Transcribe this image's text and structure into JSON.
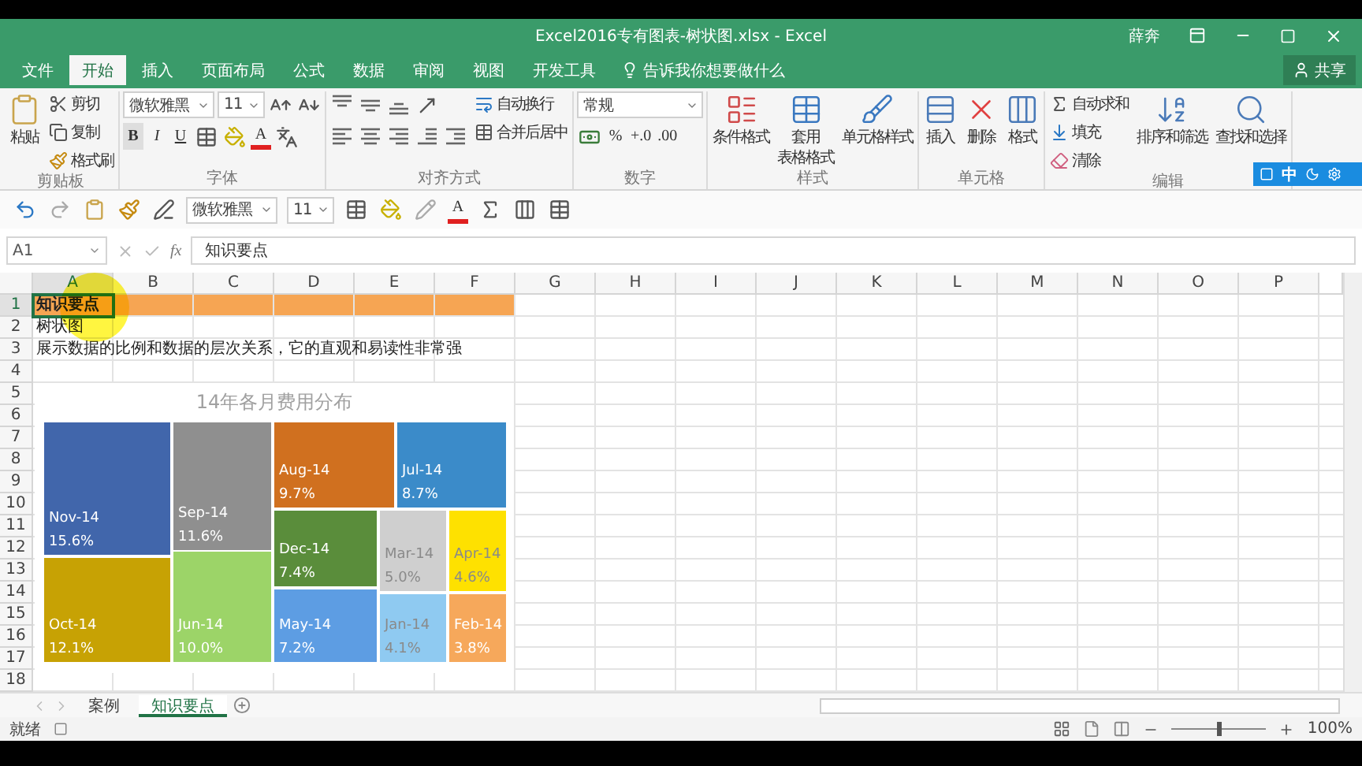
{
  "window": {
    "title": "Excel2016专有图表-树状图.xlsx - Excel",
    "user": "薛奔"
  },
  "menu_tabs": [
    {
      "label": "文件",
      "selected": false
    },
    {
      "label": "开始",
      "selected": true
    },
    {
      "label": "插入",
      "selected": false
    },
    {
      "label": "页面布局",
      "selected": false
    },
    {
      "label": "公式",
      "selected": false
    },
    {
      "label": "数据",
      "selected": false
    },
    {
      "label": "审阅",
      "selected": false
    },
    {
      "label": "视图",
      "selected": false
    },
    {
      "label": "开发工具",
      "selected": false
    }
  ],
  "tell_me": "告诉我你想要做什么",
  "share": "共享",
  "ribbon": {
    "groups": [
      {
        "label": "剪贴板",
        "columns": [
          [
            {
              "kind": "paste",
              "label": "粘贴"
            }
          ],
          [
            {
              "kind": "cut",
              "label": "剪切"
            },
            {
              "kind": "copy",
              "label": "复制"
            },
            {
              "kind": "brush",
              "label": "格式刷"
            }
          ]
        ]
      },
      {
        "label": "字体",
        "columns": [
          [
            {
              "kind": "row",
              "items": [
                {
                  "kind": "field",
                  "value": "微软雅黑"
                },
                {
                  "kind": "field",
                  "value": "11"
                },
                {
                  "kind": "grow"
                },
                {
                  "kind": "shrink"
                }
              ]
            },
            {
              "kind": "row",
              "items": [
                {
                  "kind": "bold",
                  "label": "B"
                },
                {
                  "kind": "italic",
                  "label": "I"
                },
                {
                  "kind": "underline",
                  "label": "U"
                },
                {
                  "kind": "border"
                },
                {
                  "kind": "fill"
                },
                {
                  "kind": "fontcolor",
                  "label": "A"
                },
                {
                  "kind": "phonetic"
                }
              ]
            }
          ]
        ]
      },
      {
        "label": "对齐方式",
        "columns": [
          [
            {
              "kind": "row",
              "items": [
                {
                  "kind": "vtop"
                },
                {
                  "kind": "vmid"
                },
                {
                  "kind": "vbottom"
                },
                {
                  "kind": "orient"
                }
              ]
            },
            {
              "kind": "row",
              "items": [
                {
                  "kind": "hleft"
                },
                {
                  "kind": "hcenter"
                },
                {
                  "kind": "hright"
                },
                {
                  "kind": "outdent"
                },
                {
                  "kind": "indent"
                }
              ]
            }
          ],
          [
            {
              "kind": "wrap",
              "label": "自动换行"
            },
            {
              "kind": "merge",
              "label": "合并后居中"
            }
          ]
        ]
      },
      {
        "label": "数字",
        "columns": [
          [
            {
              "kind": "field",
              "value": "常规"
            },
            {
              "kind": "row",
              "items": [
                {
                  "kind": "currency"
                },
                {
                  "kind": "percent",
                  "label": "%"
                },
                {
                  "kind": "decinc",
                  "label": "+.0"
                },
                {
                  "kind": "decdec",
                  "label": ".00"
                }
              ]
            }
          ]
        ]
      },
      {
        "label": "样式",
        "columns": [
          [
            {
              "kind": "condfmt",
              "label": "条件格式"
            }
          ],
          [
            {
              "kind": "tablefmt",
              "label_lines": [
                "套用",
                "表格格式"
              ]
            }
          ],
          [
            {
              "kind": "cellstyle",
              "label": "单元格样式"
            }
          ]
        ]
      },
      {
        "label": "单元格",
        "columns": [
          [
            {
              "kind": "insert",
              "label": "插入"
            }
          ],
          [
            {
              "kind": "delete",
              "label": "删除"
            }
          ],
          [
            {
              "kind": "format",
              "label": "格式"
            }
          ]
        ]
      },
      {
        "label": "编辑",
        "columns": [
          [
            {
              "kind": "sum",
              "label": "自动求和"
            },
            {
              "kind": "filldown",
              "label": "填充"
            },
            {
              "kind": "clear",
              "label": "清除"
            }
          ],
          [
            {
              "kind": "sort",
              "label": "排序和筛选"
            }
          ],
          [
            {
              "kind": "find",
              "label": "查找和选择"
            }
          ]
        ]
      }
    ]
  },
  "ime": {
    "label": "中"
  },
  "quick_toolbar": [
    {
      "kind": "undo"
    },
    {
      "kind": "redo"
    },
    {
      "kind": "paste"
    },
    {
      "kind": "brush"
    },
    {
      "kind": "quickedit"
    },
    {
      "kind": "field",
      "value": "微软雅黑"
    },
    {
      "kind": "field",
      "value": "11"
    },
    {
      "kind": "border"
    },
    {
      "kind": "fill"
    },
    {
      "kind": "pen"
    },
    {
      "kind": "fontcolor",
      "label": "A"
    },
    {
      "kind": "sum"
    },
    {
      "kind": "columns"
    },
    {
      "kind": "merge"
    }
  ],
  "formula_bar": {
    "name_box": "A1",
    "fx": "fx",
    "content": "知识要点"
  },
  "sheet": {
    "columns": [
      "A",
      "B",
      "C",
      "D",
      "E",
      "F",
      "G",
      "H",
      "I",
      "J",
      "K",
      "L",
      "M",
      "N",
      "O",
      "P"
    ],
    "rows": [
      {
        "label": "1",
        "text": "知识要点",
        "highlighted": true,
        "selected": true
      },
      {
        "label": "2",
        "text": "树状图",
        "highlighted": false,
        "selected": false
      },
      {
        "label": "3",
        "text": "展示数据的比例和数据的层次关系，它的直观和易读性非常强",
        "highlighted": false,
        "selected": false
      },
      {
        "label": "4"
      },
      {
        "label": "5"
      },
      {
        "label": "6"
      },
      {
        "label": "7"
      },
      {
        "label": "8"
      },
      {
        "label": "9"
      },
      {
        "label": "10"
      },
      {
        "label": "11"
      },
      {
        "label": "12"
      },
      {
        "label": "13"
      },
      {
        "label": "14"
      },
      {
        "label": "15"
      },
      {
        "label": "16"
      },
      {
        "label": "17"
      },
      {
        "label": "18"
      }
    ]
  },
  "chart": {
    "title": "14年各月费用分布",
    "tiles": [
      {
        "label": "Nov-14",
        "value": "15.6%",
        "color": "#4166ab"
      },
      {
        "label": "Oct-14",
        "value": "12.1%",
        "color": "#c7a204"
      },
      {
        "label": "Sep-14",
        "value": "11.6%",
        "color": "#8f8f8f"
      },
      {
        "label": "Jun-14",
        "value": "10.0%",
        "color": "#9cd468"
      },
      {
        "label": "Aug-14",
        "value": "9.7%",
        "color": "#d0701f"
      },
      {
        "label": "Jul-14",
        "value": "8.7%",
        "color": "#3b8bc9"
      },
      {
        "label": "Dec-14",
        "value": "7.4%",
        "color": "#5a8d3b"
      },
      {
        "label": "May-14",
        "value": "7.2%",
        "color": "#5d9de3"
      },
      {
        "label": "Mar-14",
        "value": "5.0%",
        "color": "#cfcfcf"
      },
      {
        "label": "Apr-14",
        "value": "4.6%",
        "color": "#fee100"
      },
      {
        "label": "Jan-14",
        "value": "4.1%",
        "color": "#8fcaf1"
      },
      {
        "label": "Feb-14",
        "value": "3.8%",
        "color": "#f6a85b"
      }
    ]
  },
  "sheet_tabs": [
    {
      "label": "案例",
      "selected": false
    },
    {
      "label": "知识要点",
      "selected": true
    }
  ],
  "status_bar": {
    "status": "就绪",
    "zoom": "100%",
    "zoom_level": {
      "level": 0.5
    }
  }
}
